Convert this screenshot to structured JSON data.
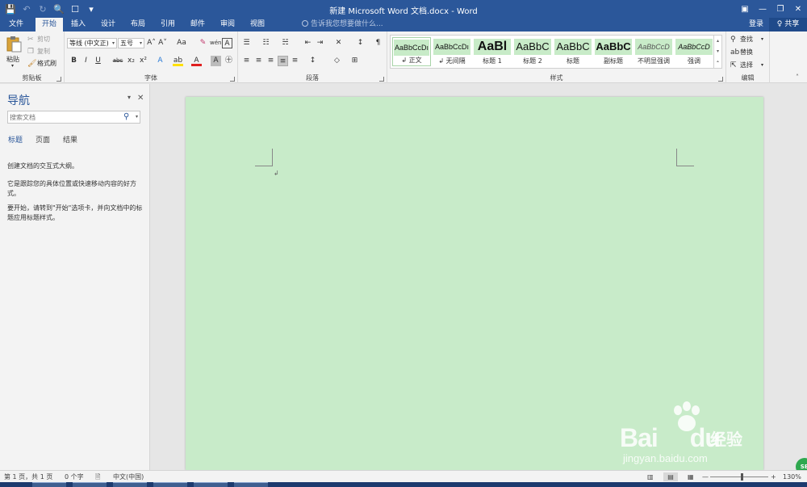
{
  "window": {
    "title": "新建 Microsoft Word 文档.docx - Word",
    "min_label": "—",
    "restore_label": "❐",
    "close_label": "✕",
    "ribbon_display_label": "▣"
  },
  "qat": {
    "save": "💾",
    "undo": "↶",
    "redo": "↻",
    "preview": "🔍",
    "touch": "☐",
    "more": "▾"
  },
  "tabs": [
    "文件",
    "开始",
    "插入",
    "设计",
    "布局",
    "引用",
    "邮件",
    "审阅",
    "视图"
  ],
  "active_tab": "开始",
  "tellme": "告诉我您想要做什么...",
  "account": {
    "login": "登录",
    "share": "♀ 共享"
  },
  "clipboard": {
    "label": "剪贴板",
    "paste": "粘贴",
    "cut": "剪切",
    "copy": "复制",
    "format_painter": "格式刷"
  },
  "font": {
    "label": "字体",
    "name": "等线 (中文正)",
    "size": "五号",
    "grow": "A˄",
    "shrink": "A˅",
    "case": "Aa",
    "clear": "✎",
    "phonetic": "wén",
    "border": "A",
    "bold": "B",
    "italic": "I",
    "underline": "U",
    "strike": "abc",
    "sub": "x₂",
    "sup": "x²",
    "effects": "A",
    "highlight": "ab",
    "color": "A",
    "shading": "A",
    "enclose": "㊉"
  },
  "paragraph": {
    "label": "段落",
    "bullets": "☰",
    "numbering": "☷",
    "multilevel": "☵",
    "decrease_indent": "⇤",
    "increase_indent": "⇥",
    "chinese_layout": "✕",
    "sort": "↕",
    "show_marks": "¶",
    "align_left": "≡",
    "center": "≡",
    "align_right": "≡",
    "justify": "≡",
    "distributed": "≡",
    "line_spacing": "↕",
    "shading": "◇",
    "borders": "⊞"
  },
  "styles": {
    "label": "样式",
    "items": [
      {
        "preview": "AaBbCcDı",
        "name": "↲ 正文"
      },
      {
        "preview": "AaBbCcDı",
        "name": "↲ 无间隔"
      },
      {
        "preview": "AaBl",
        "name": "标题 1"
      },
      {
        "preview": "AaBbC",
        "name": "标题 2"
      },
      {
        "preview": "AaBbC",
        "name": "标题"
      },
      {
        "preview": "AaBbC",
        "name": "副标题"
      },
      {
        "preview": "AaBbCcD",
        "name": "不明显强调"
      },
      {
        "preview": "AaBbCcD",
        "name": "强调"
      }
    ]
  },
  "editing": {
    "label": "编辑",
    "find": "查找",
    "replace": "替换",
    "select": "选择"
  },
  "nav": {
    "title": "导航",
    "search_placeholder": "搜索文档",
    "tabs": [
      "标题",
      "页面",
      "结果"
    ],
    "text1": "创建文档的交互式大纲。",
    "text2": "它是跟踪您的具体位置或快速移动内容的好方式。",
    "text3": "要开始，请转到\"开始\"选项卡，并向文档中的标题应用标题样式。"
  },
  "document": {
    "para_mark": "↲"
  },
  "statusbar": {
    "page": "第 1 页，共 1 页",
    "words": "0 个字",
    "lang": "中文(中国)",
    "zoom": "130%",
    "zoom_minus": "—",
    "zoom_plus": "+"
  },
  "watermark": {
    "brand": "Bai",
    "brand2": "du",
    "cn": "经验",
    "url": "jingyan.baidu.com",
    "badge": "SB"
  },
  "colors": {
    "title_bar": "#2b579a",
    "page": "#c8ebc9",
    "ribbon": "#f3f3f3"
  }
}
